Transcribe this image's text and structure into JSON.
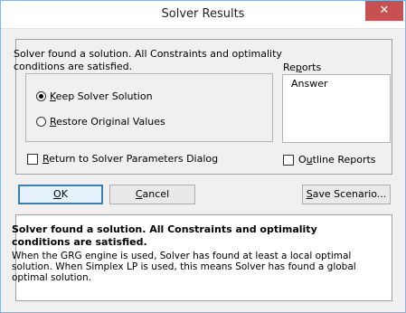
{
  "window": {
    "title": "Solver Results",
    "close_glyph": "✕"
  },
  "message": "Solver found a solution.  All Constraints and optimality conditions are satisfied.",
  "options": {
    "keep": {
      "ul": "K",
      "rest": "eep Solver Solution",
      "selected": true
    },
    "restore": {
      "ul": "R",
      "rest": "estore Original Values",
      "selected": false
    }
  },
  "reports": {
    "label_pre": "Re",
    "label_ul": "p",
    "label_post": "orts",
    "items": [
      "Answer"
    ]
  },
  "checks": {
    "return": {
      "ul": "R",
      "rest": "eturn to Solver Parameters Dialog",
      "checked": false
    },
    "outline": {
      "pre": "O",
      "ul": "u",
      "rest": "tline Reports",
      "checked": false
    }
  },
  "buttons": {
    "ok": {
      "ul": "O",
      "rest": "K"
    },
    "cancel": {
      "ul": "C",
      "rest": "ancel"
    },
    "save": {
      "ul": "S",
      "rest": "ave Scenario..."
    }
  },
  "info": {
    "title": "Solver found a solution.  All Constraints and optimality conditions are satisfied.",
    "body": "When the GRG engine is used, Solver has found at least a local optimal solution. When Simplex LP is used, this means Solver has found a global optimal solution."
  }
}
